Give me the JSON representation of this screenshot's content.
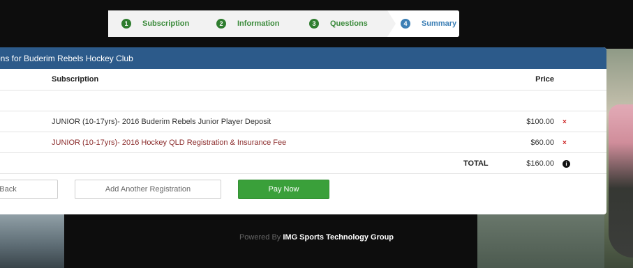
{
  "stepper": {
    "steps": [
      {
        "num": "1",
        "label": "Subscription"
      },
      {
        "num": "2",
        "label": "Information"
      },
      {
        "num": "3",
        "label": "Questions"
      },
      {
        "num": "4",
        "label": "Summary"
      }
    ]
  },
  "panel": {
    "title": "ons for Buderim Rebels Hockey Club",
    "columns": {
      "subscription": "Subscription",
      "price": "Price"
    },
    "items": [
      {
        "description": "JUNIOR (10-17yrs)- 2016 Buderim Rebels Junior Player Deposit",
        "price": "$100.00",
        "action": "×"
      },
      {
        "description": "JUNIOR (10-17yrs)- 2016 Hockey QLD Registration & Insurance Fee",
        "price": "$60.00",
        "action": "×"
      }
    ],
    "total": {
      "label": "TOTAL",
      "amount": "$160.00",
      "info_icon": "i"
    }
  },
  "buttons": {
    "back": "Back",
    "add": "Add Another Registration",
    "pay": "Pay Now"
  },
  "footer": {
    "powered_by": "Powered By",
    "brand": "IMG Sports Technology Group"
  },
  "colors": {
    "header": "#2c5a8a",
    "pay": "#3aa03a",
    "step_done": "#2f7d2f",
    "step_active": "#3c7fb5",
    "remove": "#cc2222"
  }
}
